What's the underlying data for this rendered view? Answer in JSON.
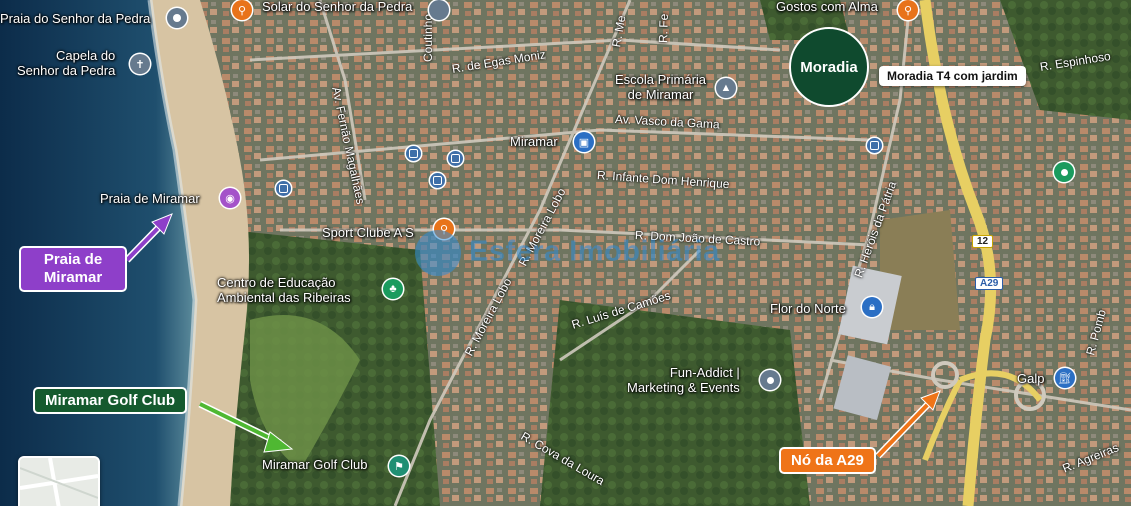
{
  "places": {
    "praia_senhor_pedra": "Praia do Senhor da Pedra",
    "solar": "Solar do Senhor da Pedra",
    "capela": "Capela do\nSenhor da Pedra",
    "gostos": "Gostos com Alma",
    "escola": "Escola Primária\nde Miramar",
    "miramar": "Miramar",
    "praia_miramar": "Praia de Miramar",
    "sport_clube": "Sport Clube A S",
    "centro_educacao": "Centro de Educação\nAmbiental das Ribeiras",
    "flor_norte": "Flor do Norte",
    "fun_addict": "Fun-Addict |\nMarketing & Events",
    "galp": "Galp",
    "golf_club": "Miramar Golf Club"
  },
  "roads": {
    "egas_moniz": "R. de Egas Moniz",
    "coutinho": "Coutinho",
    "fernao": "Av. Fernão Magalhães",
    "vasco": "Av. Vasco da Gama",
    "infante": "R. Infante Dom Henrique",
    "joao_castro": "R. Dom João de Castro",
    "moreira_lobo_1": "R. Moreira Lobo",
    "moreira_lobo_2": "R. Moreira Lobo",
    "luis_camoes": "R. Luís de Camões",
    "herois": "R. Heróis da Pátria",
    "espinhoso": "R. Espinhoso",
    "cova_loura": "R. Cova da Loura",
    "agreiras": "R. Agreiras",
    "pomb": "R. Pomb",
    "r_me": "R. Me",
    "r_fe": "R. Fe",
    "shield_12": "12",
    "shield_a29": "A29"
  },
  "callouts": {
    "moradia": "Moradia",
    "moradia_label": "Moradia T4 com jardim",
    "praia": "Praia de\nMiramar",
    "golf": "Miramar Golf Club",
    "no_a29": "Nó da A29"
  },
  "watermark": "Esfera Imobiliária",
  "colors": {
    "moradia": "#0f4a2e",
    "praia_callout": "#8e3fc9",
    "golf_callout": "#155a2e",
    "a29_callout": "#ef7418",
    "poi_orange": "#e8731a",
    "poi_grey": "#667a8e",
    "poi_green": "#1a9b5e",
    "poi_purple": "#a452c9",
    "poi_blue": "#2b6fc4",
    "poi_teal": "#1f8f73"
  }
}
